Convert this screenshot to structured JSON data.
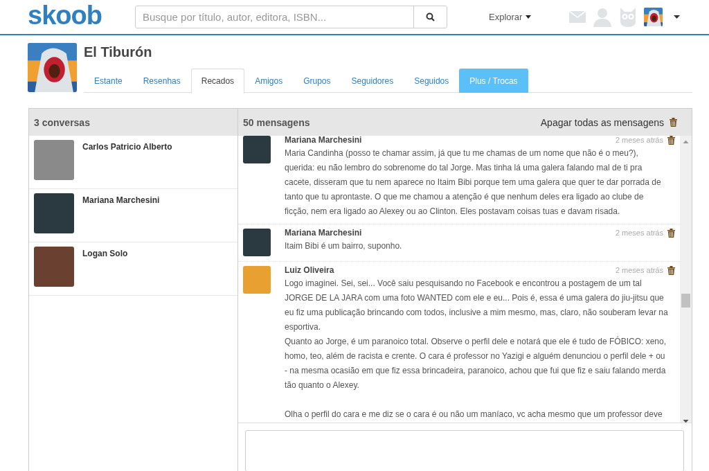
{
  "header": {
    "logo": "skoob",
    "search": {
      "placeholder": "Busque por título, autor, editora, ISBN..."
    },
    "explore": "Explorar"
  },
  "profile": {
    "name": "El Tiburón",
    "tabs": [
      {
        "label": "Estante",
        "selected": false,
        "kind": "plain"
      },
      {
        "label": "Resenhas",
        "selected": false,
        "kind": "plain"
      },
      {
        "label": "Recados",
        "selected": true,
        "kind": "plain"
      },
      {
        "label": "Amigos",
        "selected": false,
        "kind": "plain"
      },
      {
        "label": "Grupos",
        "selected": false,
        "kind": "plain"
      },
      {
        "label": "Seguidores",
        "selected": false,
        "kind": "plain"
      },
      {
        "label": "Seguidos",
        "selected": false,
        "kind": "plain"
      },
      {
        "label": "Plus / Trocas",
        "selected": false,
        "kind": "highlight"
      }
    ]
  },
  "conversations": {
    "title": "3 conversas",
    "items": [
      {
        "name": "Carlos Patricio Alberto",
        "color": "#8a8a8a"
      },
      {
        "name": "Mariana Marchesini",
        "color": "#2a3a40"
      },
      {
        "name": "Logan Solo",
        "color": "#6a4030"
      }
    ]
  },
  "messages": {
    "title": "50 mensagens",
    "delete_all": "Apagar todas as mensagens",
    "items": [
      {
        "author": "Mariana Marchesini",
        "time": "2 meses atrás",
        "color": "#2a3a40",
        "text": "Maria Candinha (posso te chamar assim, já que tu me chamas de um nome que não é o meu?), querida: eu não lembro do sobrenome do tal Jorge. Mas tinha lá uma galera falando mal de ti pra cacete, disseram que tu nem aparece no Itaim Bibi porque tem uma galera que quer te dar porrada de tanto que tu aprontaste. O que me chamou a atenção é que nenhum deles era ligado ao clube de ficção, nem era ligado ao Alexey ou ao Clinton. Eles postavam coisas tuas e davam risada."
      },
      {
        "author": "Mariana Marchesini",
        "time": "2 meses atrás",
        "color": "#2a3a40",
        "text": "Itaim Bibi é um bairro, suponho."
      },
      {
        "author": "Luiz Oliveira",
        "time": "2 meses atrás",
        "color": "#e8a030",
        "text": "Logo imaginei. Sei, sei... Você saiu pesquisando no Facebook e encontrou a postagem de um tal JORGE DE LA JARA com uma foto WANTED com ele e eu... Pois é, essa é uma galera do jiu-jitsu que eu fiz uma publicação brincando com todos, inclusive a mim mesmo, mas, claro, não souberam levar na esportiva.\nQuanto ao Jorge, é um paranoico total. Observe o perfil dele e notará que ele é tudo de FÓBICO: xeno, homo, teo, além de racista e crente. O cara é professor no Yazigi e alguém denunciou o perfil dele + ou - na mesma ocasião em que fiz essa brincadeira, paranoico, achou que fui que fiz e saiu falando merda tão quanto o Alexey.\n\nOlha o perfil do cara e me diz se o cara é ou não um maníaco, vc acha mesmo que um professor deve"
      }
    ]
  }
}
